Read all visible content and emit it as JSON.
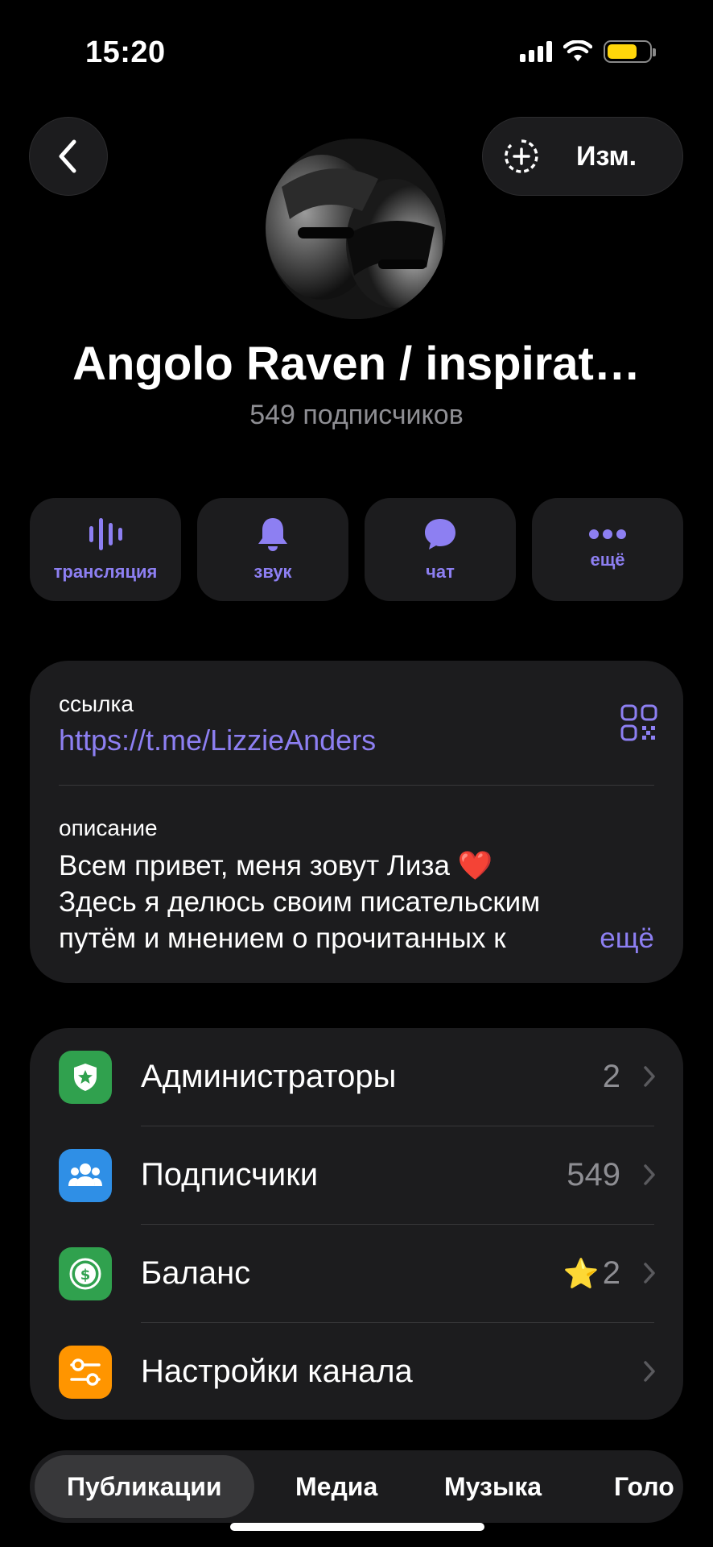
{
  "status": {
    "time": "15:20",
    "battery_color": "#ffd60a"
  },
  "header": {
    "back_icon": "chevron-left-icon",
    "edit_label": "Изм.",
    "add_story_icon": "add-story-icon"
  },
  "channel": {
    "name": "Angolo Raven / inspirat…",
    "subscribers": "549 подписчиков"
  },
  "actions": [
    {
      "label": "трансляция",
      "icon": "stream-icon"
    },
    {
      "label": "звук",
      "icon": "bell-icon"
    },
    {
      "label": "чат",
      "icon": "chat-bubble-icon"
    },
    {
      "label": "ещё",
      "icon": "more-dots-icon"
    }
  ],
  "info": {
    "link_label": "ссылка",
    "link": "https://t.me/LizzieAnders",
    "description_label": "описание",
    "description_lines": [
      "Всем привет, меня зовут Лиза ❤️",
      "Здесь я делюсь своим писательским",
      "путём и мнением о прочитанных к"
    ],
    "more": "ещё"
  },
  "menu": [
    {
      "title": "Администраторы",
      "value": "2",
      "icon": "admin-shield-icon",
      "color": "#30a14e"
    },
    {
      "title": "Подписчики",
      "value": "549",
      "icon": "people-icon",
      "color": "#2f8fe6"
    },
    {
      "title": "Баланс",
      "value": "2",
      "prefix": "⭐",
      "icon": "dollar-icon",
      "color": "#30a14e"
    },
    {
      "title": "Настройки канала",
      "value": "",
      "icon": "settings-sliders-icon",
      "color": "#ff9500"
    }
  ],
  "tabs": [
    "Публикации",
    "Медиа",
    "Музыка",
    "Голо"
  ],
  "accent": "#8d7ff2"
}
